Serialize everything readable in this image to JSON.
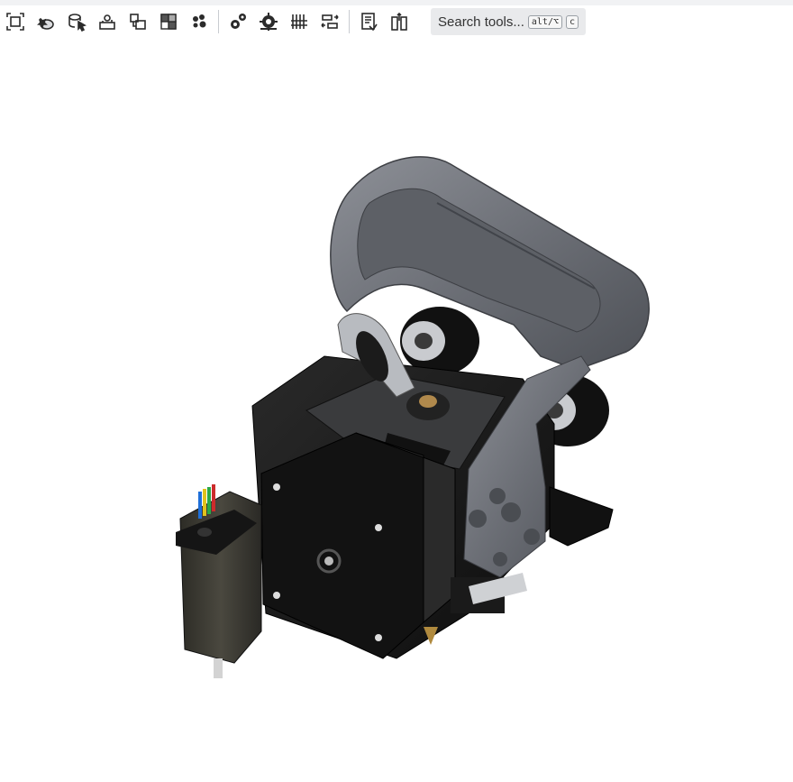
{
  "toolbar": {
    "tools": [
      {
        "icon": "fit-view-icon"
      },
      {
        "icon": "insert-part-icon"
      },
      {
        "icon": "select-part-icon"
      },
      {
        "icon": "replicate-icon"
      },
      {
        "icon": "pattern-icon"
      },
      {
        "icon": "section-view-icon"
      },
      {
        "icon": "exploded-view-icon"
      },
      {
        "icon": "mate-connector-icon"
      },
      {
        "icon": "gear-relation-icon"
      },
      {
        "icon": "rack-relation-icon"
      },
      {
        "icon": "linear-relation-icon"
      },
      {
        "icon": "bill-of-materials-icon"
      },
      {
        "icon": "measure-icon"
      }
    ],
    "search": {
      "label": "Search tools...",
      "shortcut_modifier": "alt/⌥",
      "shortcut_key": "c"
    }
  },
  "colors": {
    "toolbar_bg": "#ffffff",
    "search_bg": "#e9eaec",
    "icon": "#2b2b2b",
    "model_dark": "#161616",
    "model_gray": "#6c6f76"
  }
}
